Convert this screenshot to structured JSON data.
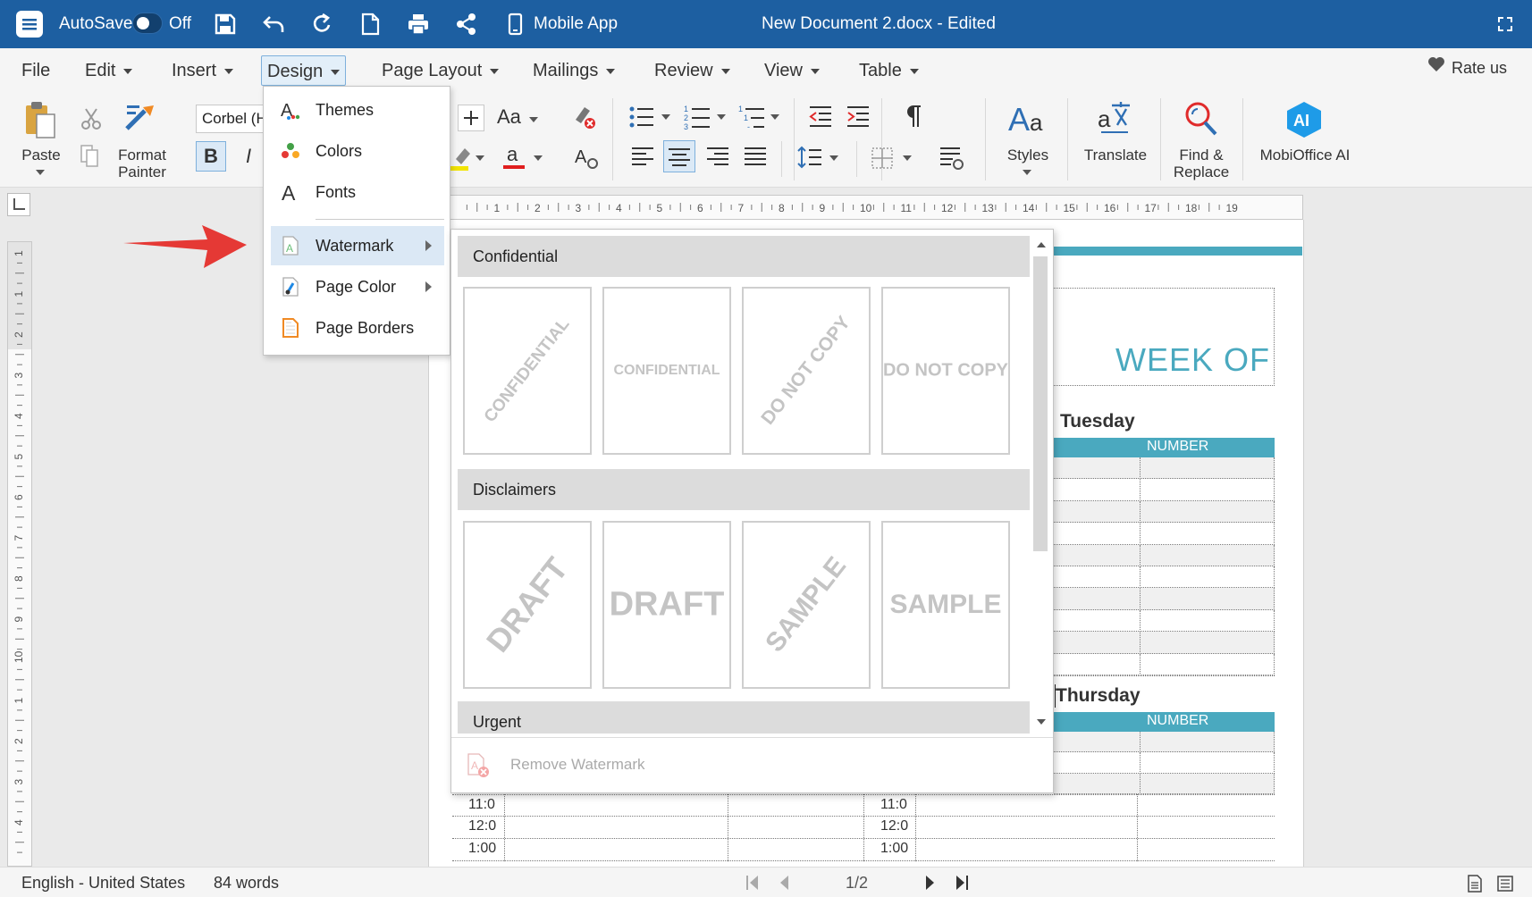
{
  "titlebar": {
    "autosave_label": "AutoSave",
    "autosave_state": "Off",
    "mobile_app_label": "Mobile App",
    "document_title": "New Document 2.docx - Edited",
    "bg_color": "#1d5fa1"
  },
  "menubar": {
    "items": [
      "File",
      "Edit",
      "Insert",
      "Design",
      "Page Layout",
      "Mailings",
      "Review",
      "View",
      "Table"
    ],
    "active": "Design",
    "rate_us": "Rate us"
  },
  "ribbon": {
    "paste": "Paste",
    "format_painter": "Format Painter",
    "font_name": "Corbel (H",
    "bold": "B",
    "italic": "I",
    "change_case": "Aa",
    "styles": "Styles",
    "translate": "Translate",
    "find_replace": "Find & Replace",
    "mobioffice_ai": "MobiOffice AI",
    "ai_badge": "AI"
  },
  "ruler": {
    "h_numbers": [
      "1",
      "2",
      "3",
      "4",
      "5",
      "6",
      "7",
      "8",
      "9",
      "10",
      "11",
      "12",
      "13",
      "14",
      "15",
      "16",
      "17",
      "18",
      "19"
    ],
    "v_numbers": [
      "1",
      "1",
      "2",
      "3",
      "4",
      "5",
      "6",
      "7",
      "8",
      "9",
      "10",
      "1",
      "2",
      "3",
      "4"
    ]
  },
  "design_menu": {
    "items": [
      {
        "label": "Themes",
        "icon": "themes-icon",
        "submenu": false
      },
      {
        "label": "Colors",
        "icon": "colors-icon",
        "submenu": false
      },
      {
        "label": "Fonts",
        "icon": "fonts-icon",
        "submenu": false
      },
      {
        "label": "Watermark",
        "icon": "watermark-icon",
        "submenu": true,
        "highlighted": true
      },
      {
        "label": "Page Color",
        "icon": "page-color-icon",
        "submenu": true
      },
      {
        "label": "Page Borders",
        "icon": "page-borders-icon",
        "submenu": false
      }
    ]
  },
  "watermark_gallery": {
    "sections": [
      {
        "title": "Confidential",
        "tiles": [
          {
            "text": "CONFIDENTIAL",
            "diagonal": true
          },
          {
            "text": "CONFIDENTIAL",
            "diagonal": false
          },
          {
            "text": "DO NOT COPY",
            "diagonal": true
          },
          {
            "text": "DO NOT COPY",
            "diagonal": false
          }
        ]
      },
      {
        "title": "Disclaimers",
        "tiles": [
          {
            "text": "DRAFT",
            "diagonal": true
          },
          {
            "text": "DRAFT",
            "diagonal": false
          },
          {
            "text": "SAMPLE",
            "diagonal": true
          },
          {
            "text": "SAMPLE",
            "diagonal": false
          }
        ]
      },
      {
        "title": "Urgent",
        "tiles": []
      }
    ],
    "remove_label": "Remove Watermark"
  },
  "document": {
    "heading": "WEEK OF",
    "day1": "Tuesday",
    "day2": "Thursday",
    "number_header": "NUMBER",
    "times_left": [
      "11:0",
      "12:0",
      "1:00"
    ],
    "times_right": [
      "11:0",
      "12:0",
      "1:00"
    ],
    "accent_color": "#4aa9bf"
  },
  "statusbar": {
    "language": "English - United States",
    "word_count": "84 words",
    "page_indicator": "1/2"
  }
}
